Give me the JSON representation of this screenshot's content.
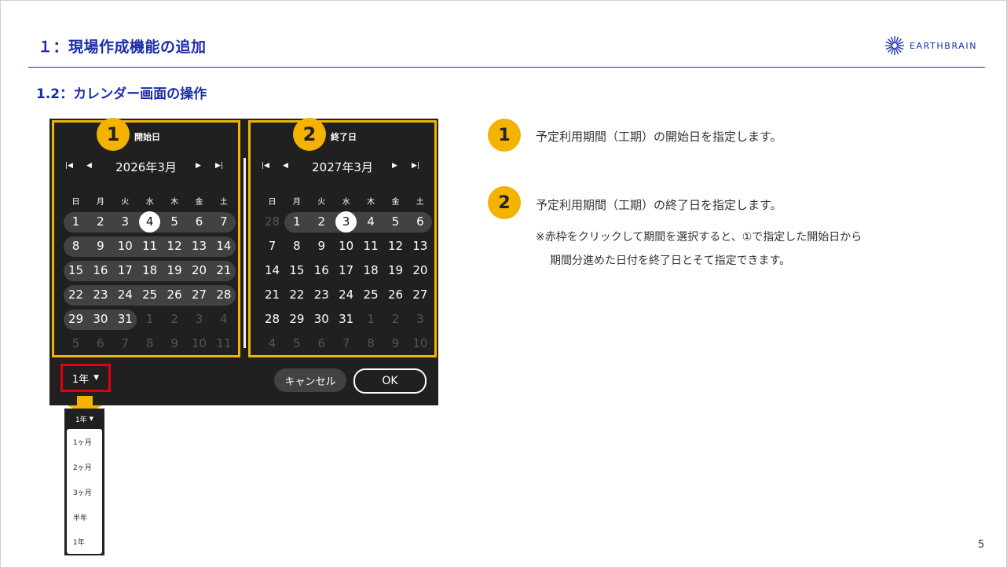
{
  "header": {
    "title": "１：現場作成機能の追加",
    "logo_text": "EARTHBRAIN",
    "brand_color": "#1b2ba8"
  },
  "subheader": {
    "title": "1.2：カレンダー画面の操作"
  },
  "calendar": {
    "start_panel": {
      "badge": "1",
      "label": "開始日",
      "month": "2026年3月",
      "selected": "4"
    },
    "end_panel": {
      "badge": "2",
      "label": "終了日",
      "month": "2027年3月",
      "selected": "3"
    },
    "weekdays": [
      "日",
      "月",
      "火",
      "水",
      "木",
      "金",
      "土"
    ],
    "start_weeks": [
      [
        "1",
        "2",
        "3",
        "4",
        "5",
        "6",
        "7"
      ],
      [
        "8",
        "9",
        "10",
        "11",
        "12",
        "13",
        "14"
      ],
      [
        "15",
        "16",
        "17",
        "18",
        "19",
        "20",
        "21"
      ],
      [
        "22",
        "23",
        "24",
        "25",
        "26",
        "27",
        "28"
      ],
      [
        "29",
        "30",
        "31",
        "1",
        "2",
        "3",
        "4"
      ],
      [
        "5",
        "6",
        "7",
        "8",
        "9",
        "10",
        "11"
      ]
    ],
    "end_weeks": [
      [
        "28",
        "1",
        "2",
        "3",
        "4",
        "5",
        "6"
      ],
      [
        "7",
        "8",
        "9",
        "10",
        "11",
        "12",
        "13"
      ],
      [
        "14",
        "15",
        "16",
        "17",
        "18",
        "19",
        "20"
      ],
      [
        "21",
        "22",
        "23",
        "24",
        "25",
        "26",
        "27"
      ],
      [
        "28",
        "29",
        "30",
        "31",
        "1",
        "2",
        "3"
      ],
      [
        "4",
        "5",
        "6",
        "7",
        "8",
        "9",
        "10"
      ]
    ],
    "footer": {
      "period_select": "1年",
      "cancel": "キャンセル",
      "ok": "OK"
    },
    "accent_color": "#f3b300",
    "highlight_color": "#e4000b"
  },
  "dropdown": {
    "selected": "1年",
    "options": [
      "1ヶ月",
      "2ヶ月",
      "3ヶ月",
      "半年",
      "1年"
    ]
  },
  "descriptions": [
    {
      "badge": "1",
      "text": "予定利用期間（工期）の開始日を指定します。"
    },
    {
      "badge": "2",
      "text": "予定利用期間（工期）の終了日を指定します。"
    }
  ],
  "note": {
    "line1": "※赤枠をクリックして期間を選択すると、①で指定した開始日から",
    "line2": "期間分進めた日付を終了日とそて指定できます。"
  },
  "page_number": "5"
}
